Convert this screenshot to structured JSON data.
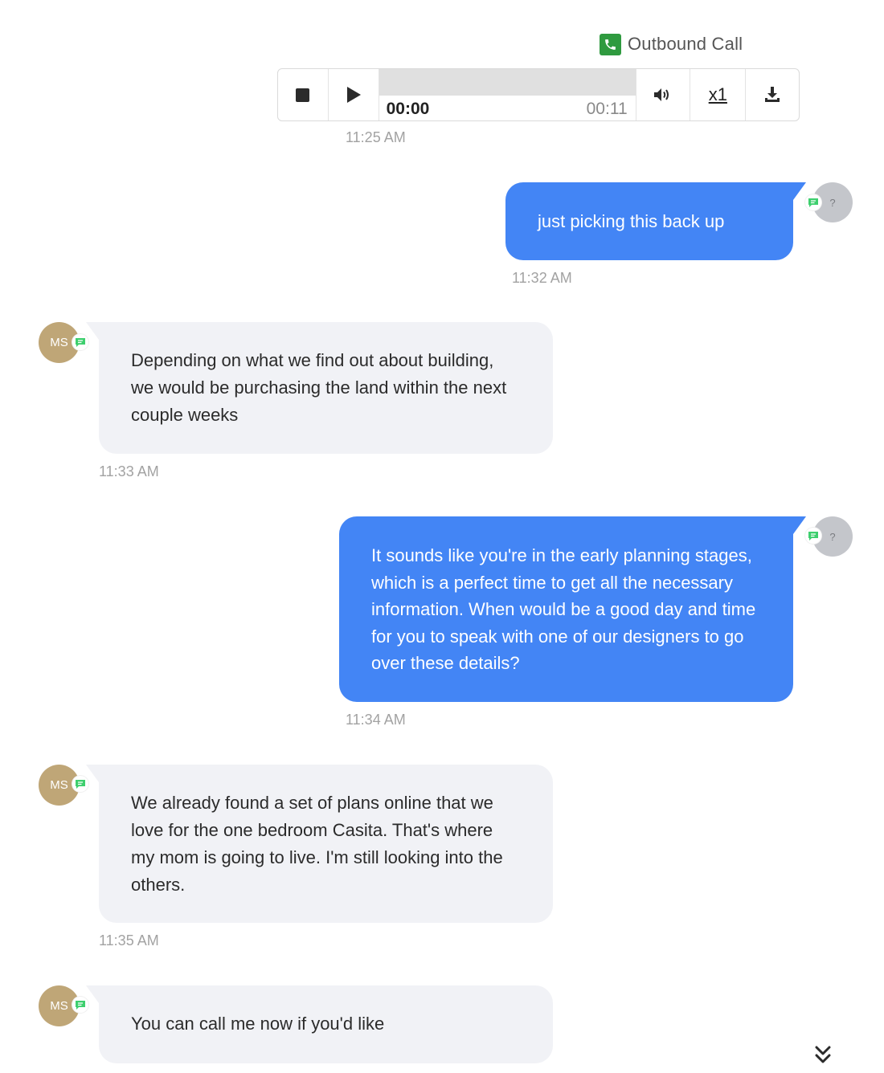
{
  "call": {
    "title": "Outbound Call",
    "icon": "phone-icon",
    "accent": "#2f9a3f",
    "player": {
      "current_time": "00:00",
      "duration": "00:11",
      "speed": "x1",
      "progress": 0
    },
    "timestamp": "11:25 AM"
  },
  "messages": [
    {
      "direction": "outbound",
      "text": "just picking this back up",
      "time": "11:32 AM",
      "avatar": "?"
    },
    {
      "direction": "inbound",
      "text": "Depending on what we find out about building, we would be purchasing the land within the next couple weeks",
      "time": "11:33 AM",
      "avatar": "MS"
    },
    {
      "direction": "outbound",
      "text": "It sounds like you're in the early planning stages, which is a perfect time to get all the necessary information. When would be a good day and time for you to speak with one of our designers to go over these details?",
      "time": "11:34 AM",
      "avatar": "?"
    },
    {
      "direction": "inbound",
      "text": "We already found a set of plans online that we love for the one bedroom Casita. That's where my mom is going to live. I'm still looking into the others.",
      "time": "11:35 AM",
      "avatar": "MS"
    },
    {
      "direction": "inbound",
      "text": "You can call me now if you'd like",
      "time": "",
      "avatar": "MS"
    }
  ],
  "colors": {
    "outbound_bubble": "#4385f5",
    "inbound_bubble": "#f1f2f6",
    "avatar_ms": "#bfa677",
    "avatar_unknown": "#c4c6cb",
    "sms_badge": "#3ecf6e"
  }
}
